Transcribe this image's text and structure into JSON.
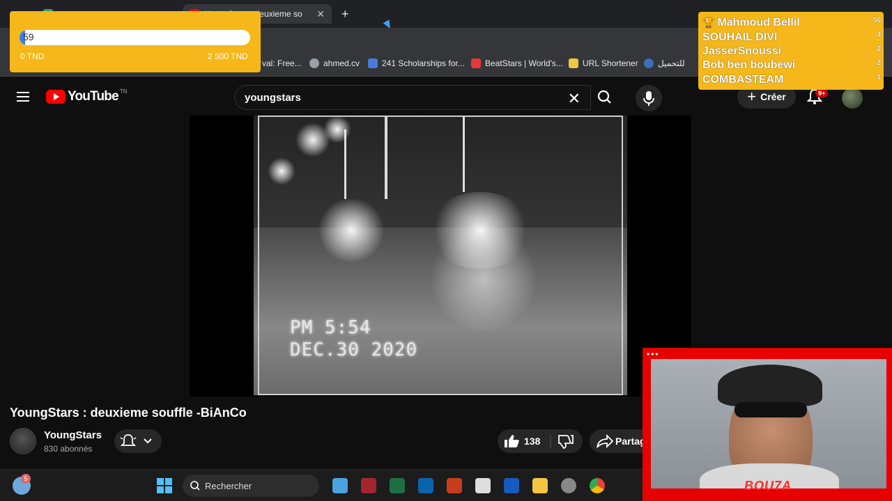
{
  "browser": {
    "tabs": [
      {
        "title": "...",
        "active": false,
        "color": "#34a853"
      },
      {
        "title": "YoungStars : deuxieme so",
        "active": true,
        "color": "#ff0000"
      }
    ],
    "bookmarks": [
      {
        "label": "val: Free...",
        "icon": "bookmark-icon"
      },
      {
        "label": "ahmed.cv",
        "icon": "globe-icon"
      },
      {
        "label": "241 Scholarships for...",
        "icon": "scholarship-icon"
      },
      {
        "label": "BeatStars | World's...",
        "icon": "beatstars-icon"
      },
      {
        "label": "URL Shortener",
        "icon": "folder-icon"
      },
      {
        "label": "للتحميل",
        "icon": "gear-icon"
      }
    ]
  },
  "youtube": {
    "logo_text": "YouTube",
    "logo_country": "TN",
    "search_value": "youngstars",
    "create_label": "Créer",
    "notification_badge": "9+"
  },
  "video": {
    "timestamp_line1": "PM  5:54",
    "timestamp_line2": "DEC.30 2020",
    "title": "YoungStars : deuxieme souffle -BiAnCo",
    "channel_name": "YoungStars",
    "channel_subs": "830 abonnés",
    "likes": "138",
    "share_label": "Partager"
  },
  "donation": {
    "current_value": "59",
    "min_label": "0 TND",
    "max_label": "2 500 TND",
    "progress_fraction": 0.024,
    "colors": {
      "panel": "#f5b71a",
      "fill": "#3a7ee8"
    }
  },
  "leaderboard": [
    {
      "name": "Mahmoud Bellil",
      "count": "50",
      "trophy": true
    },
    {
      "name": "SOUHAIL DIVI",
      "count": "4"
    },
    {
      "name": "JasserSnoussi",
      "count": "2"
    },
    {
      "name": "Bob ben boubewi",
      "count": "2"
    },
    {
      "name": "COMBASTEAM",
      "count": "1"
    }
  ],
  "webcam": {
    "label": "BOU7A"
  },
  "taskbar": {
    "search_placeholder": "Rechercher",
    "weather_badge": "5"
  }
}
